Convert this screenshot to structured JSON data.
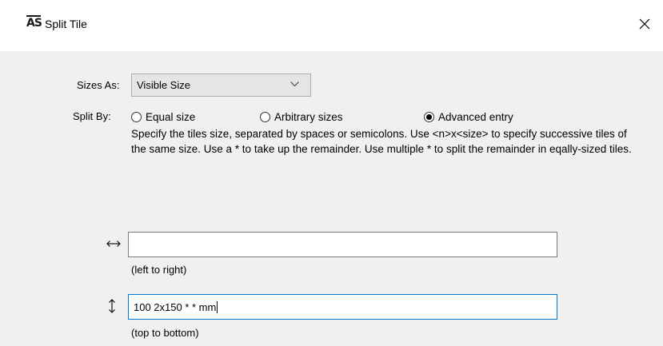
{
  "window": {
    "app_icon_text": "AS",
    "title": "Split Tile",
    "close_glyph": "close-icon"
  },
  "sizes_as": {
    "label": "Sizes As:",
    "selected": "Visible Size"
  },
  "split_by": {
    "label": "Split By:",
    "options": [
      {
        "label": "Equal size",
        "selected": false
      },
      {
        "label": "Arbitrary sizes",
        "selected": false
      },
      {
        "label": "Advanced entry",
        "selected": true
      }
    ],
    "help_text": "Specify the tiles size, separated by spaces or semicolons. Use <n>x<size> to specify successive tiles of the same size. Use a * to take up the remainder. Use multiple * to split the remainder in eqally-sized tiles."
  },
  "horizontal": {
    "icon": "left-right-arrow-icon",
    "value": "",
    "hint": "(left to right)"
  },
  "vertical": {
    "icon": "up-down-arrow-icon",
    "value": "100 2x150 * * mm",
    "hint": "(top to bottom)"
  }
}
